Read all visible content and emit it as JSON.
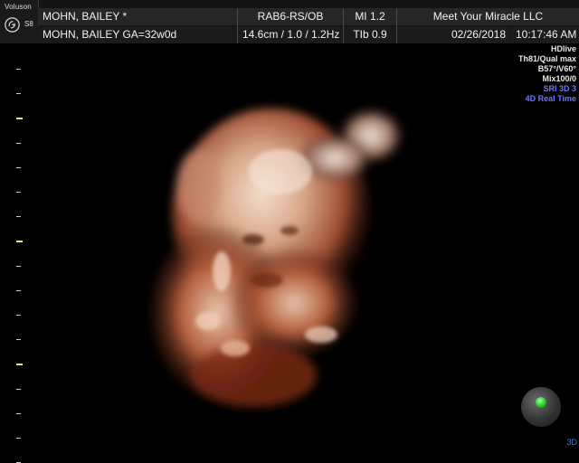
{
  "header": {
    "logo": {
      "brand": "Voluson",
      "model": "S8",
      "seal_icon": "ge-monogram-icon"
    },
    "row1": {
      "patient": "MOHN, BAILEY  *",
      "probe": "RAB6-RS/OB",
      "mi": "MI  1.2",
      "clinic": "Meet Your Miracle LLC"
    },
    "row2": {
      "patient_ga": "MOHN, BAILEY  GA=32w0d",
      "params": "14.6cm / 1.0 / 1.2Hz",
      "tib": "TIb  0.9",
      "date": "02/26/2018",
      "time": "10:17:46 AM"
    }
  },
  "side_panel": {
    "lines": [
      {
        "text": "HDlive",
        "color": "#e8e8e8"
      },
      {
        "text": "Th81/Qual max",
        "color": "#e8e8e8"
      },
      {
        "text": "B57°/V60°",
        "color": "#e8e8e8"
      },
      {
        "text": "Mix100/0",
        "color": "#e8e8e8"
      },
      {
        "text": "SRI 3D 3",
        "color": "#6f74ff"
      },
      {
        "text": "4D Real Time",
        "color": "#6f74ff"
      }
    ]
  },
  "image": {
    "subject": "3D fetal face ultrasound render"
  },
  "orientation": {
    "icon": "orientation-ball-icon",
    "label": "3D"
  },
  "colors": {
    "background": "#000000",
    "header_bg": "#262626",
    "accent_blue": "#6f74ff",
    "scale_major": "#f0e86a",
    "indicator_green": "#1ec21e"
  }
}
